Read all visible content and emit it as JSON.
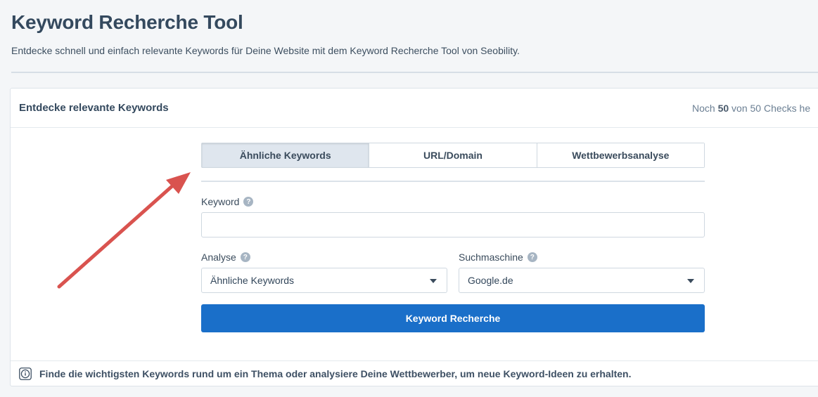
{
  "page": {
    "title": "Keyword Recherche Tool",
    "subtitle": "Entdecke schnell und einfach relevante Keywords für Deine Website mit dem Keyword Recherche Tool von Seobility."
  },
  "card": {
    "title": "Entdecke relevante Keywords",
    "checks": {
      "prefix": "Noch ",
      "remaining": "50",
      "suffix": " von 50 Checks he"
    }
  },
  "tabs": [
    {
      "label": "Ähnliche Keywords",
      "active": true
    },
    {
      "label": "URL/Domain",
      "active": false
    },
    {
      "label": "Wettbewerbsanalyse",
      "active": false
    }
  ],
  "form": {
    "keyword_label": "Keyword",
    "keyword_value": "",
    "analyse_label": "Analyse",
    "analyse_value": "Ähnliche Keywords",
    "engine_label": "Suchmaschine",
    "engine_value": "Google.de",
    "submit_label": "Keyword Recherche"
  },
  "info": {
    "text": "Finde die wichtigsten Keywords rund um ein Thema oder analysiere Deine Wettbewerber, um neue Keyword-Ideen zu erhalten."
  },
  "icons": {
    "help": "help-circle-icon",
    "info": "info-circle-icon",
    "caret": "caret-down-icon"
  },
  "colors": {
    "accent": "#1a6fc9",
    "annotation_arrow": "#d9534f"
  }
}
